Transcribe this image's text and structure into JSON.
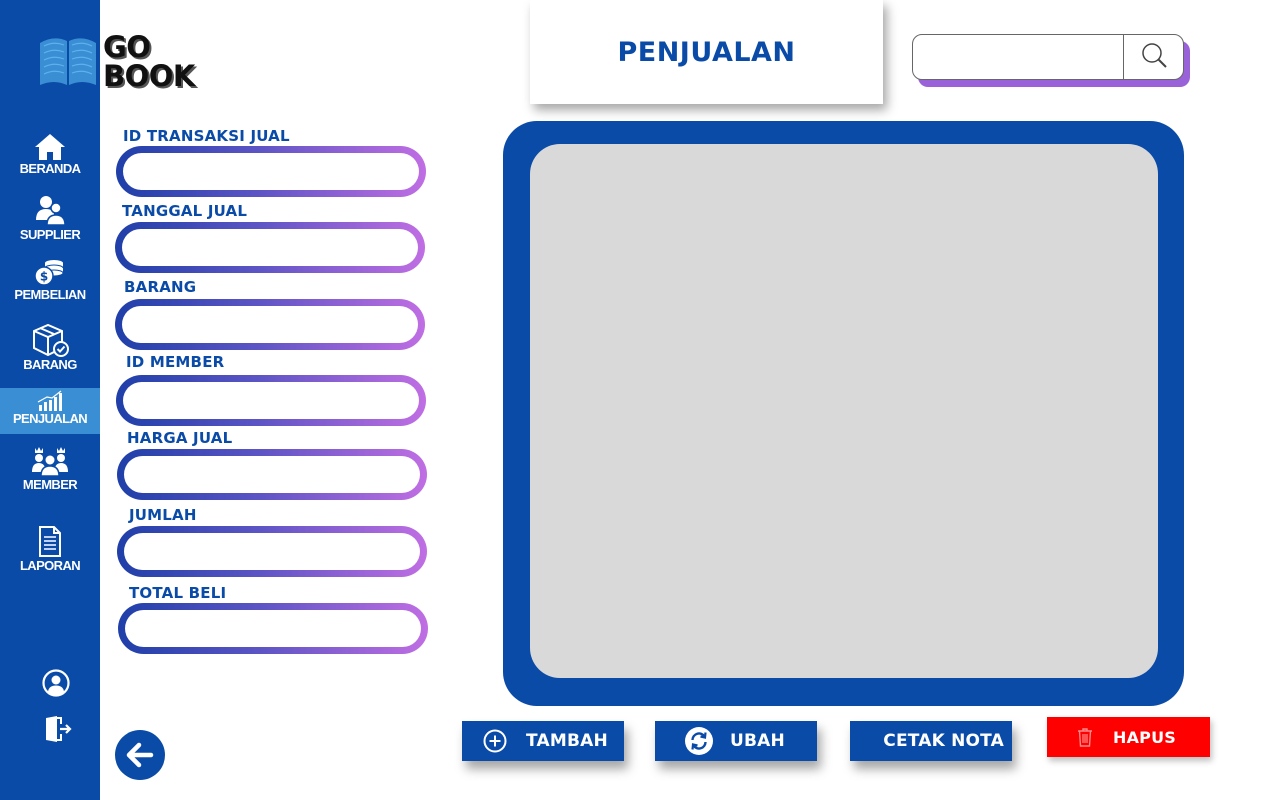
{
  "app": {
    "logo_line1": "GO",
    "logo_line2": "BOOK"
  },
  "sidebar": {
    "items": [
      {
        "label": "BERANDA",
        "icon": "home-icon"
      },
      {
        "label": "SUPPLIER",
        "icon": "users-icon"
      },
      {
        "label": "PEMBELIAN",
        "icon": "coins-icon"
      },
      {
        "label": "BARANG",
        "icon": "box-icon"
      },
      {
        "label": "PENJUALAN",
        "icon": "chart-icon",
        "active": true
      },
      {
        "label": "MEMBER",
        "icon": "members-crown-icon"
      },
      {
        "label": "LAPORAN",
        "icon": "document-icon"
      }
    ],
    "bottom_icons": [
      "profile-icon",
      "logout-icon"
    ]
  },
  "header": {
    "title": "PENJUALAN"
  },
  "search": {
    "value": "",
    "placeholder": "",
    "icon": "search-icon"
  },
  "form": {
    "fields": [
      {
        "label": "ID TRANSAKSI JUAL",
        "value": ""
      },
      {
        "label": "TANGGAL JUAL",
        "value": ""
      },
      {
        "label": "BARANG",
        "value": ""
      },
      {
        "label": "ID MEMBER",
        "value": ""
      },
      {
        "label": "HARGA JUAL",
        "value": ""
      },
      {
        "label": "JUMLAH",
        "value": ""
      },
      {
        "label": "TOTAL BELI",
        "value": ""
      }
    ]
  },
  "actions": {
    "tambah": "TAMBAH",
    "ubah": "UBAH",
    "cetak_nota": "CETAK NOTA",
    "hapus": "HAPUS"
  },
  "colors": {
    "primary": "#0a4ba8",
    "active_nav": "#3a8fd4",
    "accent_purple": "#c06ee3",
    "danger": "#ff0000",
    "table_bg": "#d9d9d9"
  }
}
